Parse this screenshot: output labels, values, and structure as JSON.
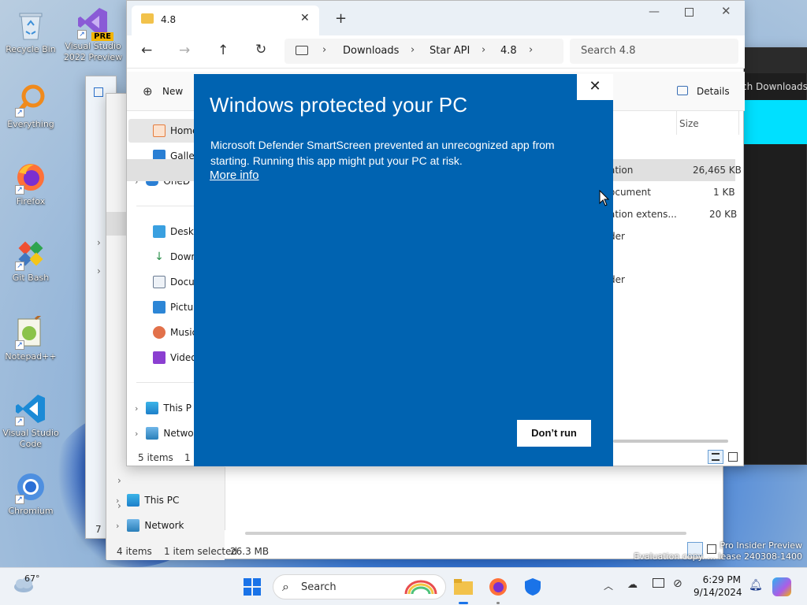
{
  "desktop": {
    "icons": [
      {
        "label": "Recycle Bin"
      },
      {
        "label": "Visual Studio 2022 Preview",
        "badge": "PRE"
      },
      {
        "label": "Everything"
      },
      {
        "label": "Firefox"
      },
      {
        "label": "Git Bash"
      },
      {
        "label": "Notepad++"
      },
      {
        "label": "Visual Studio Code"
      },
      {
        "label": "Chromium"
      }
    ],
    "watermark_line1": "Pro Insider Preview",
    "watermark_line2": "Evaluation copy. ... lease 240308-1400"
  },
  "explorer_front": {
    "tab_title": "4.8",
    "new_tab": "+",
    "breadcrumb": [
      "Downloads",
      "Star API",
      "4.8"
    ],
    "search_placeholder": "Search 4.8",
    "toolbar_new": "New",
    "details_label": "Details",
    "column_size": "Size",
    "sidebar": [
      {
        "label": "Home",
        "icon": "home-icon"
      },
      {
        "label": "Galler",
        "icon": "gallery-icon"
      },
      {
        "label": "OneD",
        "icon": "onedrive-icon"
      },
      {
        "label": "Deskto",
        "icon": "desktop-folder-icon"
      },
      {
        "label": "Down",
        "icon": "downloads-icon"
      },
      {
        "label": "Docu",
        "icon": "documents-icon"
      },
      {
        "label": "Pictur",
        "icon": "pictures-icon"
      },
      {
        "label": "Music",
        "icon": "music-icon"
      },
      {
        "label": "Video",
        "icon": "videos-icon"
      },
      {
        "label": "This P",
        "icon": "this-pc-icon"
      },
      {
        "label": "Netwo",
        "icon": "network-icon"
      }
    ],
    "files": [
      {
        "type": "ation",
        "size": "26,465 KB"
      },
      {
        "type": "ocument",
        "size": "1 KB"
      },
      {
        "type": "ation extens...",
        "size": "20 KB"
      },
      {
        "type": "der",
        "size": ""
      },
      {
        "type": "der",
        "size": ""
      }
    ],
    "status_items": "5 items",
    "status_selected": "1 i"
  },
  "explorer_back": {
    "sidebar": [
      {
        "label": "This PC"
      },
      {
        "label": "Network"
      }
    ],
    "status_items": "4 items",
    "status_selected": "1 item selected",
    "status_size": "26.3 MB",
    "search_hint": "ch Downloads",
    "partial_items": "7"
  },
  "smartscreen": {
    "title": "Windows protected your PC",
    "body": "Microsoft Defender SmartScreen prevented an unrecognized app from starting. Running this app might put your PC at risk.",
    "more_info": "More info",
    "dont_run": "Don’t run",
    "close": "✕",
    "bg_color": "#0063b1"
  },
  "taskbar": {
    "weather_temp": "67°",
    "search_label": "Search",
    "time": "6:29 PM",
    "date": "9/14/2024"
  }
}
